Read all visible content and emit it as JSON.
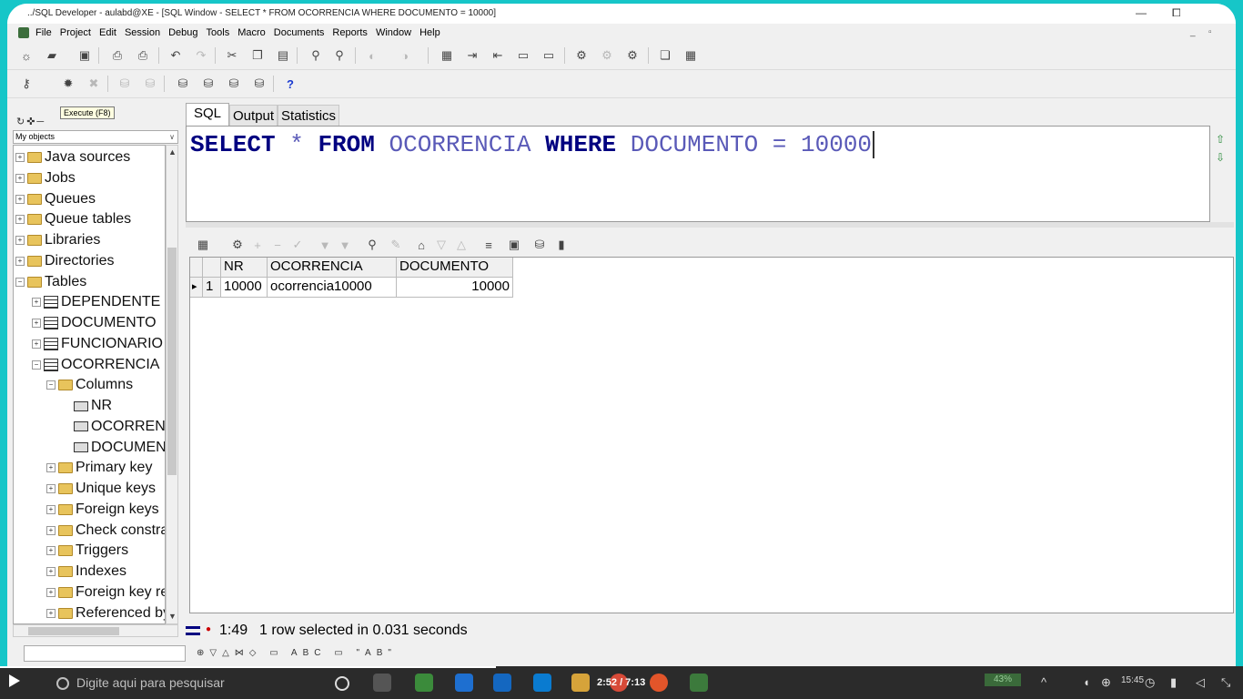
{
  "window": {
    "title": "../SQL Developer - aulabd@XE - [SQL Window - SELECT * FROM OCORRENCIA WHERE DOCUMENTO = 10000]",
    "min": "—",
    "max": "⧠"
  },
  "menu": [
    "File",
    "Project",
    "Edit",
    "Session",
    "Debug",
    "Tools",
    "Macro",
    "Documents",
    "Reports",
    "Window",
    "Help"
  ],
  "tooltip": "Execute (F8)",
  "left_panel": {
    "selector": "My objects",
    "tree": [
      {
        "label": "Java sources",
        "level": 0,
        "type": "folder",
        "expander": "+"
      },
      {
        "label": "Jobs",
        "level": 0,
        "type": "folder",
        "expander": "+"
      },
      {
        "label": "Queues",
        "level": 0,
        "type": "folder",
        "expander": "+"
      },
      {
        "label": "Queue tables",
        "level": 0,
        "type": "folder",
        "expander": "+"
      },
      {
        "label": "Libraries",
        "level": 0,
        "type": "folder",
        "expander": "+"
      },
      {
        "label": "Directories",
        "level": 0,
        "type": "folder",
        "expander": "+"
      },
      {
        "label": "Tables",
        "level": 0,
        "type": "folder",
        "expander": "−"
      },
      {
        "label": "DEPENDENTE",
        "level": 1,
        "type": "table",
        "expander": "+"
      },
      {
        "label": "DOCUMENTO",
        "level": 1,
        "type": "table",
        "expander": "+"
      },
      {
        "label": "FUNCIONARIO",
        "level": 1,
        "type": "table",
        "expander": "+"
      },
      {
        "label": "OCORRENCIA",
        "level": 1,
        "type": "table",
        "expander": "−"
      },
      {
        "label": "Columns",
        "level": 2,
        "type": "folder",
        "expander": "−"
      },
      {
        "label": "NR",
        "level": 3,
        "type": "column",
        "expander": ""
      },
      {
        "label": "OCORRENCIA",
        "level": 3,
        "type": "column",
        "expander": ""
      },
      {
        "label": "DOCUMENTO",
        "level": 3,
        "type": "column",
        "expander": ""
      },
      {
        "label": "Primary key",
        "level": 2,
        "type": "folder",
        "expander": "+"
      },
      {
        "label": "Unique keys",
        "level": 2,
        "type": "folder",
        "expander": "+"
      },
      {
        "label": "Foreign keys",
        "level": 2,
        "type": "folder",
        "expander": "+"
      },
      {
        "label": "Check constraints",
        "level": 2,
        "type": "folder",
        "expander": "+"
      },
      {
        "label": "Triggers",
        "level": 2,
        "type": "folder",
        "expander": "+"
      },
      {
        "label": "Indexes",
        "level": 2,
        "type": "folder",
        "expander": "+"
      },
      {
        "label": "Foreign key references",
        "level": 2,
        "type": "folder",
        "expander": "+"
      },
      {
        "label": "Referenced by",
        "level": 2,
        "type": "folder",
        "expander": "+"
      }
    ]
  },
  "tabs": [
    "SQL",
    "Output",
    "Statistics"
  ],
  "editor": {
    "tokens": [
      {
        "t": "SELECT",
        "c": "kw"
      },
      {
        "t": " ",
        "c": ""
      },
      {
        "t": "*",
        "c": "op"
      },
      {
        "t": " ",
        "c": ""
      },
      {
        "t": "FROM",
        "c": "kw"
      },
      {
        "t": " ",
        "c": ""
      },
      {
        "t": "OCORRENCIA",
        "c": "id"
      },
      {
        "t": " ",
        "c": ""
      },
      {
        "t": "WHERE",
        "c": "kw"
      },
      {
        "t": " ",
        "c": ""
      },
      {
        "t": "DOCUMENTO",
        "c": "id"
      },
      {
        "t": " ",
        "c": ""
      },
      {
        "t": "=",
        "c": "op"
      },
      {
        "t": " ",
        "c": ""
      },
      {
        "t": "10000",
        "c": "id"
      }
    ]
  },
  "grid": {
    "columns": [
      "",
      "",
      "NR",
      "OCORRENCIA",
      "DOCUMENTO"
    ],
    "rows": [
      {
        "marker": "▸",
        "num": "1",
        "cells": [
          "10000",
          "ocorrencia10000",
          "10000"
        ]
      }
    ]
  },
  "status": {
    "position": "1:49",
    "message": "1 row selected in 0.031 seconds"
  },
  "find_icons": "⊕▽△⋈◇ ▭ ABC ▭ \"AB\"",
  "taskbar": {
    "search_placeholder": "Digite aqui para pesquisar",
    "timecode": "2:52 / 7:13",
    "battery": "43%",
    "clock": "15:45"
  },
  "colors": {
    "keyword": "#000080",
    "identifier": "#5a5ab8",
    "desktop": "#16c6c8"
  }
}
